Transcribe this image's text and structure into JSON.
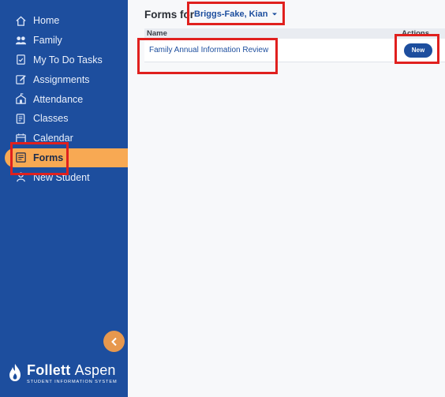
{
  "sidebar": {
    "items": [
      {
        "label": "Home",
        "icon": "home-icon"
      },
      {
        "label": "Family",
        "icon": "family-icon"
      },
      {
        "label": "My To Do Tasks",
        "icon": "todo-icon"
      },
      {
        "label": "Assignments",
        "icon": "assignments-icon"
      },
      {
        "label": "Attendance",
        "icon": "attendance-icon"
      },
      {
        "label": "Classes",
        "icon": "classes-icon"
      },
      {
        "label": "Calendar",
        "icon": "calendar-icon"
      },
      {
        "label": "Forms",
        "icon": "forms-icon",
        "active": true
      },
      {
        "label": "New Student",
        "icon": "new-student-icon"
      }
    ],
    "collapse_icon": "chevron-left-icon",
    "brand": {
      "name_bold": "Follett",
      "name_light": "Aspen",
      "tagline": "STUDENT INFORMATION SYSTEM"
    }
  },
  "main": {
    "title": "Forms for",
    "student": "Briggs-Fake, Kian",
    "table": {
      "columns": [
        "Name",
        "Actions"
      ],
      "rows": [
        {
          "name": "Family Annual Information Review",
          "action": "New"
        }
      ]
    }
  },
  "colors": {
    "sidebar_bg": "#1d4e9e",
    "active_item": "#f8a953",
    "highlight": "#e0201e",
    "accent": "#1d4e9e"
  }
}
